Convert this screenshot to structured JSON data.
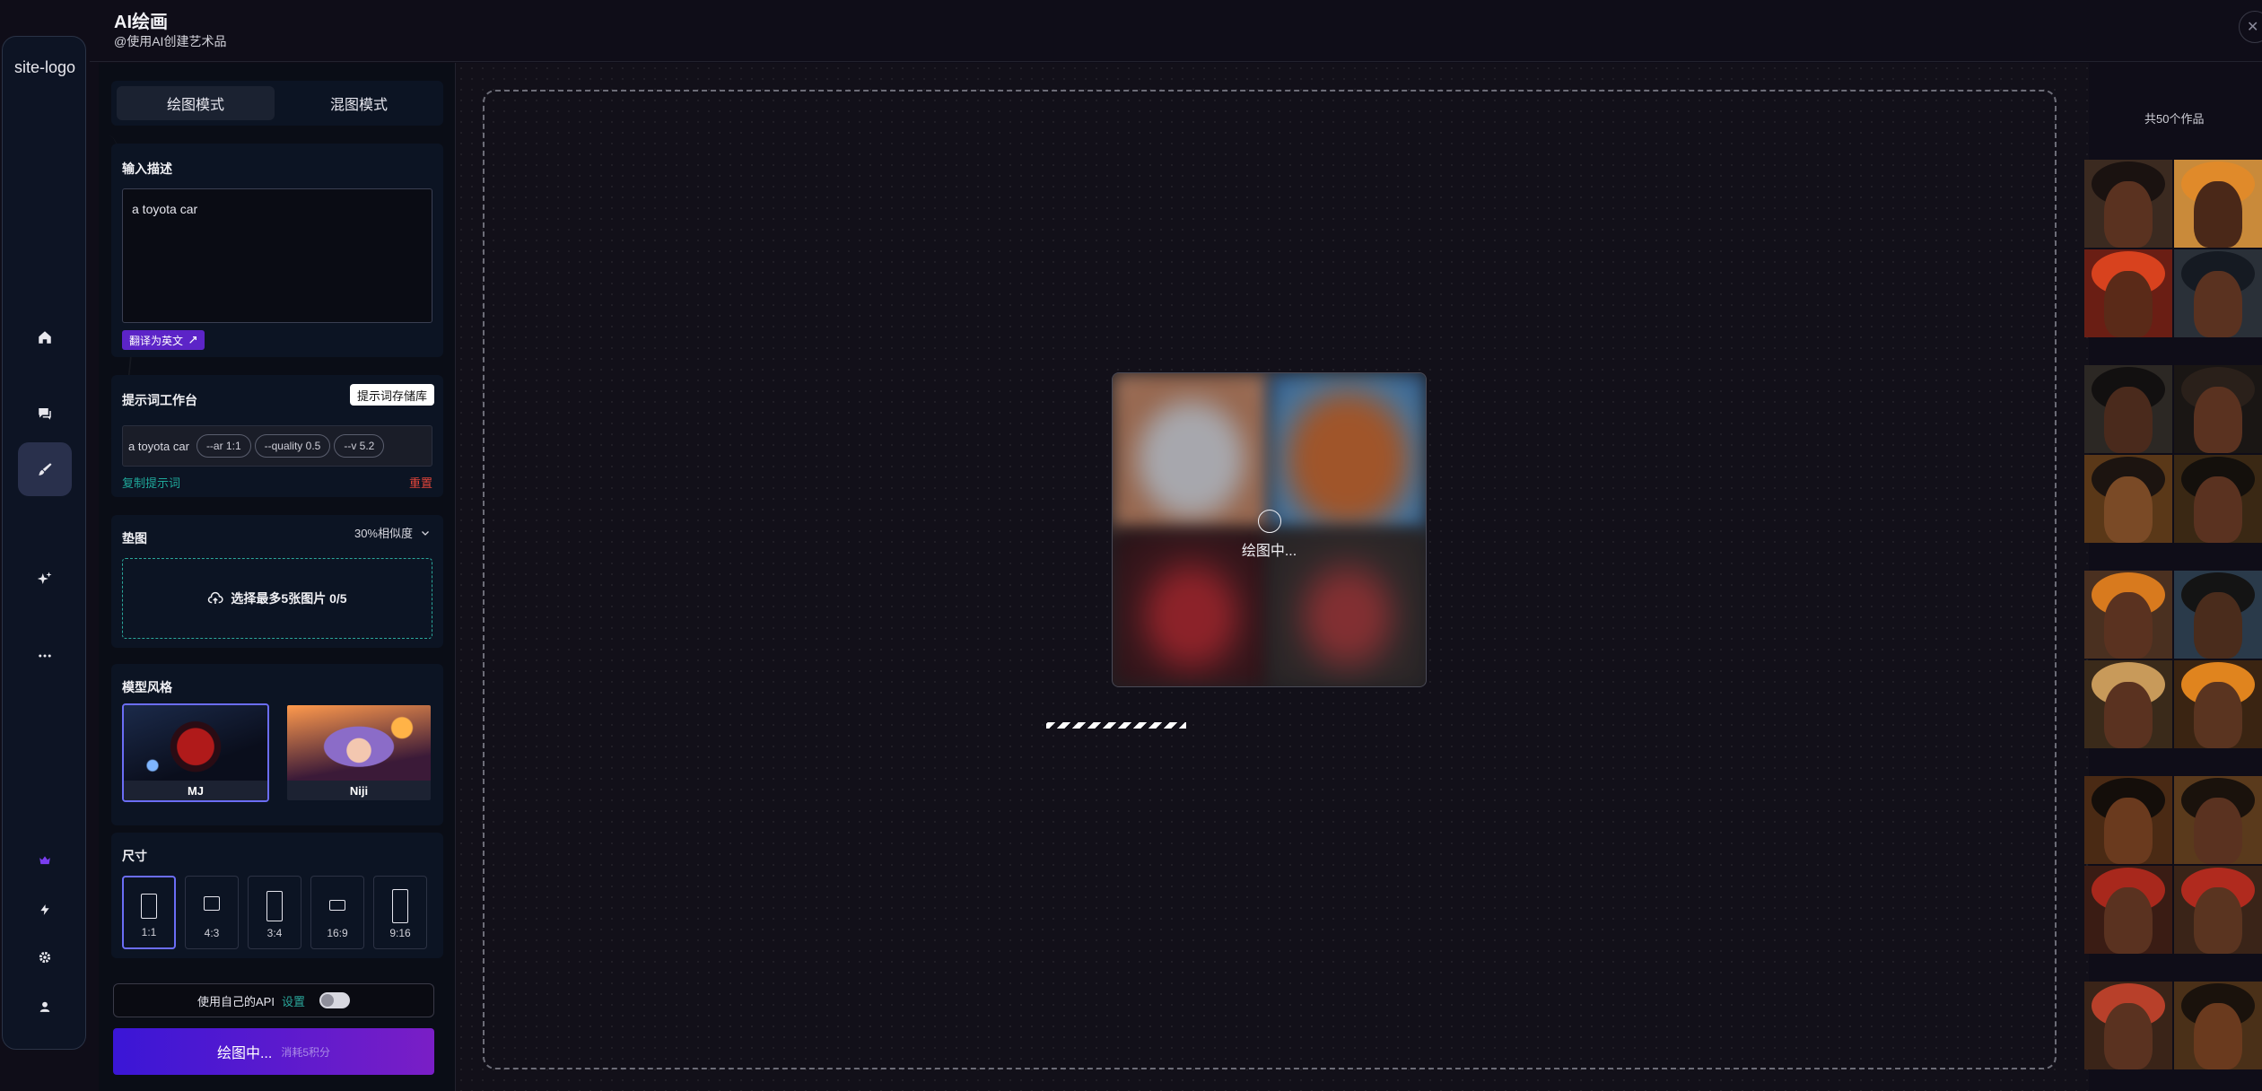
{
  "app": {
    "title": "AI绘画",
    "subtitle": "@使用AI创建艺术品",
    "logo_text": "site-logo"
  },
  "close_icon": "close-icon",
  "rail": {
    "items": [
      {
        "name": "home",
        "icon": "home-icon"
      },
      {
        "name": "chat",
        "icon": "chat-icon"
      },
      {
        "name": "draw",
        "icon": "brush-icon",
        "active": true
      },
      {
        "name": "magic",
        "icon": "sparkle-icon"
      },
      {
        "name": "more",
        "icon": "more-icon"
      }
    ],
    "bottom_items": [
      {
        "name": "crown",
        "icon": "crown-icon"
      },
      {
        "name": "bolt",
        "icon": "bolt-icon"
      },
      {
        "name": "settings",
        "icon": "gear-icon"
      },
      {
        "name": "user",
        "icon": "user-icon"
      }
    ]
  },
  "mode_tabs": {
    "draw": "绘图模式",
    "blend": "混图模式",
    "active": "draw"
  },
  "prompt": {
    "label": "输入描述",
    "value": "a toyota car",
    "translate_label": "翻译为英文"
  },
  "workbench": {
    "label": "提示词工作台",
    "store_button": "提示词存储库",
    "prompt_text": "a toyota car",
    "chips": [
      "--ar 1:1",
      "--quality 0.5",
      "--v 5.2"
    ],
    "copy_label": "复制提示词",
    "reset_label": "重置"
  },
  "base_image": {
    "label": "垫图",
    "similarity": "30%相似度",
    "upload_text": "选择最多5张图片 0/5"
  },
  "model_style": {
    "label": "模型风格",
    "models": [
      {
        "label": "MJ",
        "selected": true
      },
      {
        "label": "Niji",
        "selected": false
      }
    ]
  },
  "size": {
    "label": "尺寸",
    "options": [
      {
        "label": "1:1",
        "selected": true
      },
      {
        "label": "4:3",
        "selected": false
      },
      {
        "label": "3:4",
        "selected": false
      },
      {
        "label": "16:9",
        "selected": false
      },
      {
        "label": "9:16",
        "selected": false
      }
    ]
  },
  "api": {
    "label": "使用自己的API",
    "settings_link": "设置",
    "enabled": false
  },
  "draw_button": {
    "label": "绘图中...",
    "cost": "消耗5积分"
  },
  "canvas": {
    "status": "绘图中..."
  },
  "gallery": {
    "count_label": "共50个作品"
  },
  "colors": {
    "accent": "#5c24c7",
    "teal": "#1fa89a",
    "danger": "#e0453a",
    "selected_border": "#6b6df5"
  }
}
